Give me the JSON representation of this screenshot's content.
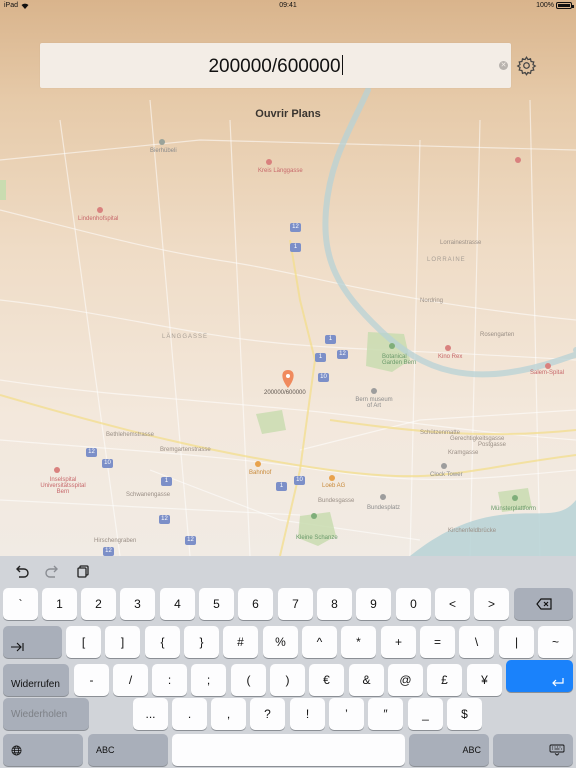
{
  "status_bar": {
    "device": "iPad",
    "time": "09:41",
    "battery": "100%"
  },
  "search": {
    "value": "200000/600000"
  },
  "action": {
    "open_plans": "Ouvrir Plans"
  },
  "map": {
    "pin_label": "200000/600000",
    "districts": [
      "LÄNGGASSE",
      "LORRAINE"
    ],
    "labels": {
      "bierhuebeli": "Bierhübeli",
      "kreis_laenggasse": "Kreis Länggasse",
      "lindenhofspital": "Lindenhofspital",
      "botanical_garden": "Botanical Garden Bern",
      "kino_rex": "Kino Rex",
      "bern_museum": "Bern museum of Art",
      "inselspital": "Inselspital Universitätsspital Bern",
      "kleine_schanze": "Kleine Schanze",
      "loeb": "Loeb AG",
      "bern_bahnhof": "Bahnhof",
      "muensterplattform": "Münsterplattform",
      "salem_spital": "Salem-Spital",
      "zytglogge": "Zytglogge",
      "clock_tower": "Clock Tower",
      "bundesplatz": "Bundesplatz",
      "hirschengraben": "Hirschengraben",
      "kirchenfeldbruecke": "Kirchenfeldbrücke",
      "gesellschaftsstrasse": "Gesellschaftsstrasse",
      "schuetzenmatt": "Schützenmatte",
      "postgasse": "Postgasse",
      "brunngasse": "Brunngasse",
      "lorrainestrasse": "Lorrainestrasse",
      "nordring": "Nordring",
      "bundesgasse": "Bundesgasse",
      "schwanengasse": "Schwanengasse",
      "gerechtigkeitsgasse": "Gerechtigkeitsgasse",
      "kramgasse": "Kramgasse",
      "rosengarten": "Rosengarten",
      "bethlehemstrasse": "Bethlehemstrasse",
      "bremgartenstrasse": "Bremgartenstrasse"
    },
    "route_badges": [
      "12",
      "1",
      "10",
      "12",
      "1",
      "12",
      "10",
      "1",
      "10",
      "1",
      "12",
      "12",
      "12"
    ]
  },
  "keyboard": {
    "toolbar": {
      "undo_icon": "undo-icon",
      "redo_icon": "redo-icon",
      "paste_icon": "paste-icon"
    },
    "row1": [
      "`",
      "1",
      "2",
      "3",
      "4",
      "5",
      "6",
      "7",
      "8",
      "9",
      "0",
      "<",
      ">"
    ],
    "row2": [
      "[",
      "]",
      "{",
      "}",
      "#",
      "%",
      "^",
      "*",
      "+",
      "=",
      "\\",
      "|",
      "~"
    ],
    "row3_left": "Widerrufen",
    "row3": [
      "-",
      "/",
      ":",
      ";",
      "(",
      ")",
      "€",
      "&",
      "@",
      "£",
      "¥"
    ],
    "row4_left": "Wiederholen",
    "row4": [
      "...",
      ".",
      ",",
      "?",
      "!",
      "’",
      "″",
      "_",
      "$"
    ],
    "abc_left": "ABC",
    "abc_right": "ABC",
    "tab_icon": "tab-arrow-icon",
    "delete_icon": "delete-icon",
    "return_icon": "return-icon",
    "globe_icon": "globe-icon",
    "dismiss_icon": "keyboard-dismiss-icon"
  },
  "colors": {
    "return_key": "#1a82fb",
    "keyboard_bg": "#d1d4d9",
    "pin": "#f08a5d"
  }
}
